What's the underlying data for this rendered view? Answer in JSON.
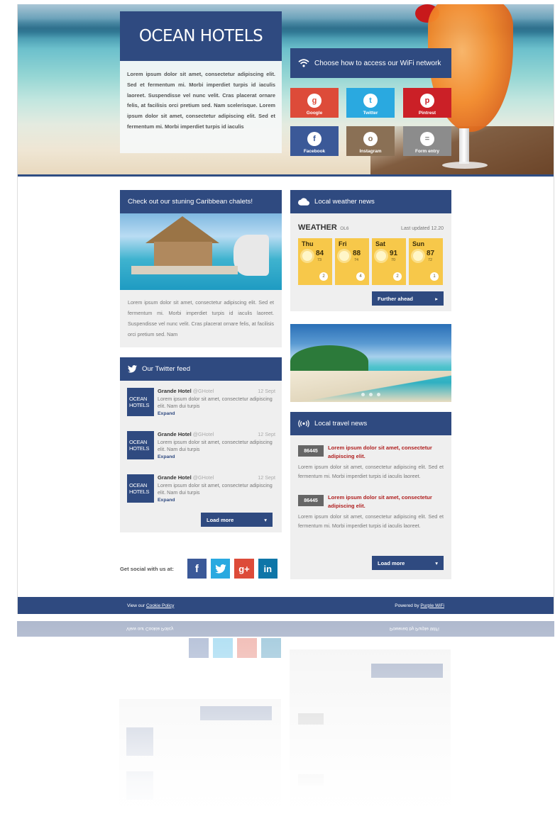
{
  "brand": {
    "title": "OCEAN HOTELS",
    "intro": "Lorem ipsum dolor sit amet, consectetur adipiscing elit. Sed et fermentum mi. Morbi imperdiet turpis id iaculis laoreet. Suspendisse vel nunc velit. Cras placerat ornare felis, at facilisis orci pretium sed. Nam scelerisque. Lorem ipsum dolor sit amet, consectetur adipiscing elit. Sed et fermentum mi. Morbi imperdiet turpis id iaculis"
  },
  "wifi": {
    "heading": "Choose how to access our WiFi network",
    "options": [
      {
        "label": "Google",
        "icon": "google-icon",
        "color": "#dd4b39",
        "glyph": "g"
      },
      {
        "label": "Twitter",
        "icon": "twitter-icon",
        "color": "#2aa9e0",
        "glyph": "t"
      },
      {
        "label": "Pintrest",
        "icon": "pinterest-icon",
        "color": "#cb2027",
        "glyph": "p"
      },
      {
        "label": "Facebook",
        "icon": "facebook-icon",
        "color": "#3b5998",
        "glyph": "f"
      },
      {
        "label": "Instagram",
        "icon": "instagram-icon",
        "color": "#8a7055",
        "glyph": "o"
      },
      {
        "label": "Form entry",
        "icon": "form-icon",
        "color": "#8c8c8c",
        "glyph": "="
      }
    ]
  },
  "chalets": {
    "heading": "Check out our stuning Caribbean chalets!",
    "text": "Lorem ipsum dolor sit amet, consectetur adipiscing elit. Sed et fermentum mi. Morbi imperdiet turpis id iaculis laoreet. Suspendisse vel nunc velit. Cras placerat ornare felis, at facilisis orci pretium sed. Nam"
  },
  "twitter": {
    "heading": "Our Twitter feed",
    "logo_line1": "OCEAN",
    "logo_line2": "HOTELS",
    "tweets": [
      {
        "name": "Grande Hotel",
        "handle": "@GHotel",
        "date": "12 Sept",
        "text": "Lorem ipsum dolor sit amet, consectetur adipiscing elit. Nam dui turpis",
        "expand": "Expand"
      },
      {
        "name": "Grande Hotel",
        "handle": "@GHotel",
        "date": "12 Sept",
        "text": "Lorem ipsum dolor sit amet, consectetur adipiscing elit. Nam dui turpis",
        "expand": "Expand"
      },
      {
        "name": "Grande Hotel",
        "handle": "@GHotel",
        "date": "12 Sept",
        "text": "Lorem ipsum dolor sit amet, consectetur adipiscing elit. Nam dui turpis",
        "expand": "Expand"
      }
    ],
    "load_more": "Load more"
  },
  "social": {
    "label": "Get social with us at:",
    "links": [
      {
        "icon": "facebook-icon",
        "glyph": "f",
        "color": "#3b5998"
      },
      {
        "icon": "twitter-icon",
        "glyph": "t",
        "color": "#2aa9e0"
      },
      {
        "icon": "google-plus-icon",
        "glyph": "g+",
        "color": "#dd4b39"
      },
      {
        "icon": "linkedin-icon",
        "glyph": "in",
        "color": "#0e76a8"
      }
    ]
  },
  "weather": {
    "heading": "Local weather news",
    "title": "WEATHER",
    "location": "OL6",
    "updated": "Last updated 12.20",
    "days": [
      {
        "day": "Thu",
        "high": "84",
        "low": "73",
        "wind": "2"
      },
      {
        "day": "Fri",
        "high": "88",
        "low": "74",
        "wind": "4"
      },
      {
        "day": "Sat",
        "high": "91",
        "low": "70",
        "wind": "2"
      },
      {
        "day": "Sun",
        "high": "87",
        "low": "72",
        "wind": "1"
      }
    ],
    "further": "Further ahead"
  },
  "travel": {
    "heading": "Local travel news",
    "items": [
      {
        "id": "86445",
        "title": "Lorem ipsum dolor sit amet, consectetur adipiscing elit.",
        "text": "Lorem ipsum dolor sit amet, consectetur adipiscing elit. Sed et fermentum mi. Morbi imperdiet turpis id iaculis laoreet."
      },
      {
        "id": "86445",
        "title": "Lorem ipsum dolor sit amet, consectetur adipiscing elit.",
        "text": "Lorem ipsum dolor sit amet, consectetur adipiscing elit. Sed et fermentum mi. Morbi imperdiet turpis id iaculis laoreet."
      }
    ],
    "load_more": "Load more"
  },
  "footer": {
    "cookie_prefix": "View our",
    "cookie_link": "Cookie Policy",
    "powered_prefix": "Powered by",
    "powered_link": "Purple WiFi"
  }
}
